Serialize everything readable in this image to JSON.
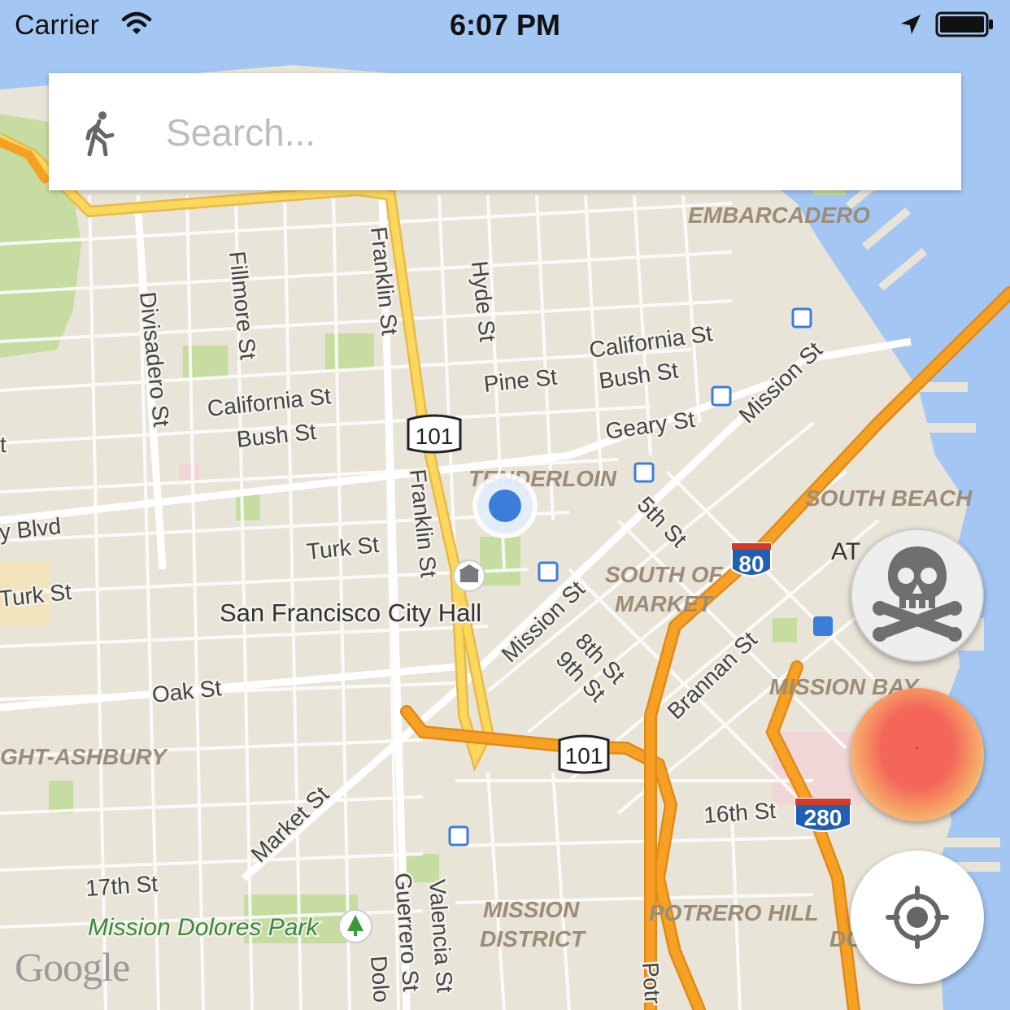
{
  "status_bar": {
    "carrier": "Carrier",
    "time": "6:07 PM",
    "wifi_icon": "wifi-icon",
    "location_icon": "location-arrow-icon",
    "battery_icon": "battery-icon"
  },
  "search": {
    "placeholder": "Search...",
    "value": "",
    "mode_icon": "walking-person-icon"
  },
  "map": {
    "attribution": "Google",
    "neighborhoods": {
      "embarcadero": "EMBARCADERO",
      "tenderloin": "TENDERLOIN",
      "south_beach": "SOUTH BEACH",
      "south_of_market_1": "SOUTH OF",
      "south_of_market_2": "MARKET",
      "mission_bay": "MISSION BAY",
      "haight_ashbury": "GHT-ASHBURY",
      "potrero_hill": "POTRERO HILL",
      "mission_district_1": "MISSION",
      "mission_district_2": "DISTRICT",
      "dogpatch_partial": "DO",
      "at_partial": "AT"
    },
    "streets": {
      "divisadero": "Divisadero St",
      "fillmore": "Fillmore St",
      "franklin_top": "Franklin St",
      "franklin_bottom": "Franklin St",
      "hyde": "Hyde St",
      "california_left": "California St",
      "california_right": "California St",
      "bush_left": "Bush St",
      "bush_right": "Bush St",
      "pine": "Pine St",
      "geary": "Geary St",
      "mission_top": "Mission St",
      "mission_mid": "Mission St",
      "fifth": "5th St",
      "eighth": "8th St",
      "ninth": "9th St",
      "turk": "Turk St",
      "turk_left": "Turk St",
      "blvd_left": "y Blvd",
      "oak": "Oak St",
      "market": "Market St",
      "brannan": "Brannan St",
      "sixteenth": "16th St",
      "seventeenth": "17th St",
      "guerrero": "Guerrero St",
      "valencia": "Valencia St",
      "dolores_partial": "Dolo",
      "potrero_partial": "Potr",
      "st_partial_left": "t"
    },
    "places": {
      "city_hall": "San Francisco City Hall",
      "dolores_park": "Mission Dolores Park"
    },
    "highway_shields": {
      "us101_north": "101",
      "us101_south": "101",
      "i80": "80",
      "i280": "280"
    },
    "colors": {
      "land": "#e9e4d8",
      "water": "#a4c6f3",
      "park": "#c6dca1",
      "freeway": "#f6a024",
      "major_road": "#fbd85c",
      "user_location": "#3b7dd8"
    }
  },
  "controls": {
    "danger_button_icon": "skull-crossbones-icon",
    "heatmap_button_icon": "heatmap-icon",
    "locate_button_icon": "crosshair-target-icon"
  }
}
